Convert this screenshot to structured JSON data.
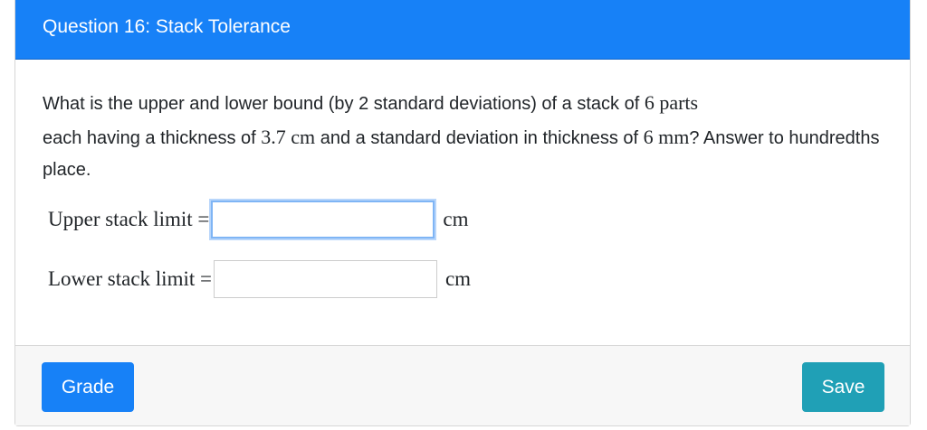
{
  "header": {
    "title": "Question 16: Stack Tolerance"
  },
  "question": {
    "t1": "What is the upper and lower bound (by 2 standard deviations) of a stack of ",
    "n_parts": "6",
    "u_parts": " parts",
    "t2": " each having a thickness of ",
    "thickness": "3.7",
    "u_cm": " cm",
    "t3": " and a standard deviation in thickness of ",
    "sd": "6",
    "u_mm": " mm",
    "t4": "? Answer to hundredths place."
  },
  "fields": [
    {
      "label": "Upper stack limit =",
      "value": "",
      "unit": "cm"
    },
    {
      "label": "Lower stack limit =",
      "value": "",
      "unit": "cm"
    }
  ],
  "footer": {
    "grade_label": "Grade",
    "save_label": "Save"
  },
  "colors": {
    "primary": "#1781f7",
    "info": "#20a0b6"
  }
}
